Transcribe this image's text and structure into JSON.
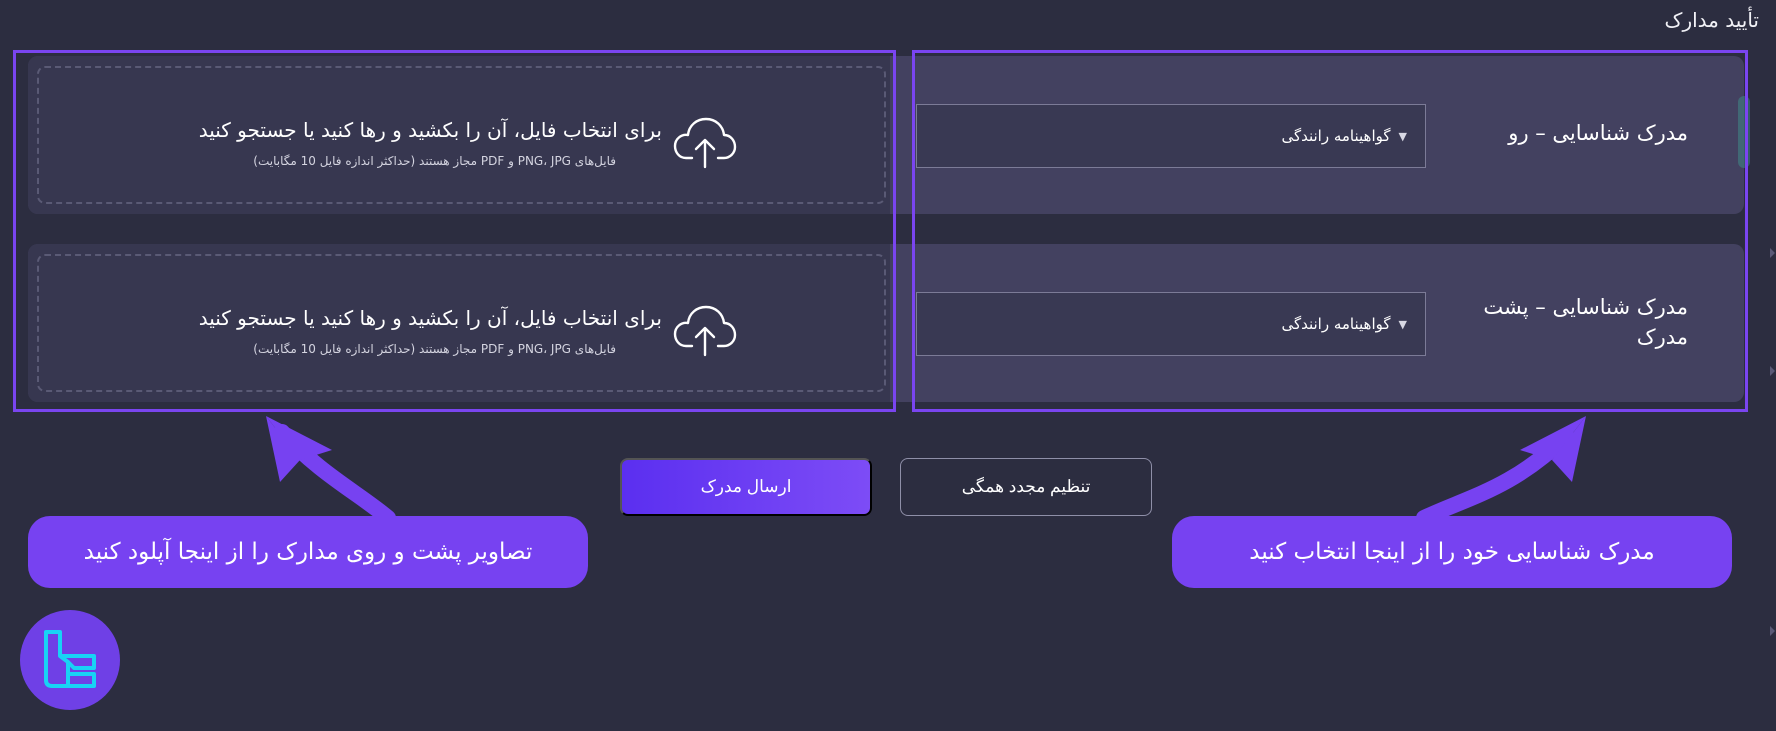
{
  "page": {
    "title": "تأیید مدارک"
  },
  "rows": [
    {
      "label": "مدرک شناسایی – رو",
      "select_value": "گواهینامه رانندگی",
      "dropzone_title": "برای انتخاب فایل، آن را بکشید و رها کنید یا جستجو کنید",
      "dropzone_hint": "فایل‌های PNG، JPG و PDF مجاز هستند (حداکثر اندازه فایل 10 مگابایت)"
    },
    {
      "label": "مدرک شناسایی – پشت مدرک",
      "select_value": "گواهینامه رانندگی",
      "dropzone_title": "برای انتخاب فایل، آن را بکشید و رها کنید یا جستجو کنید",
      "dropzone_hint": "فایل‌های PNG، JPG و PDF مجاز هستند (حداکثر اندازه فایل 10 مگابایت)"
    }
  ],
  "actions": {
    "submit_label": "ارسال مدرک",
    "reset_label": "تنظیم مجدد همگی"
  },
  "annotations": {
    "left_callout": "تصاویر پشت و روی مدارک را از اینجا آپلود کنید",
    "right_callout": "مدرک شناسایی خود را از اینجا انتخاب کنید"
  },
  "colors": {
    "background": "#2c2d40",
    "row_background": "#434160",
    "dropzone_background": "#373750",
    "accent": "#7742f1",
    "highlight_border": "#7a45f0"
  },
  "icons": {
    "upload": "cloud-upload-icon",
    "select_caret": "caret-down-icon",
    "callout_arrow": "curved-arrow-icon",
    "brand": "brand-logo-icon"
  }
}
